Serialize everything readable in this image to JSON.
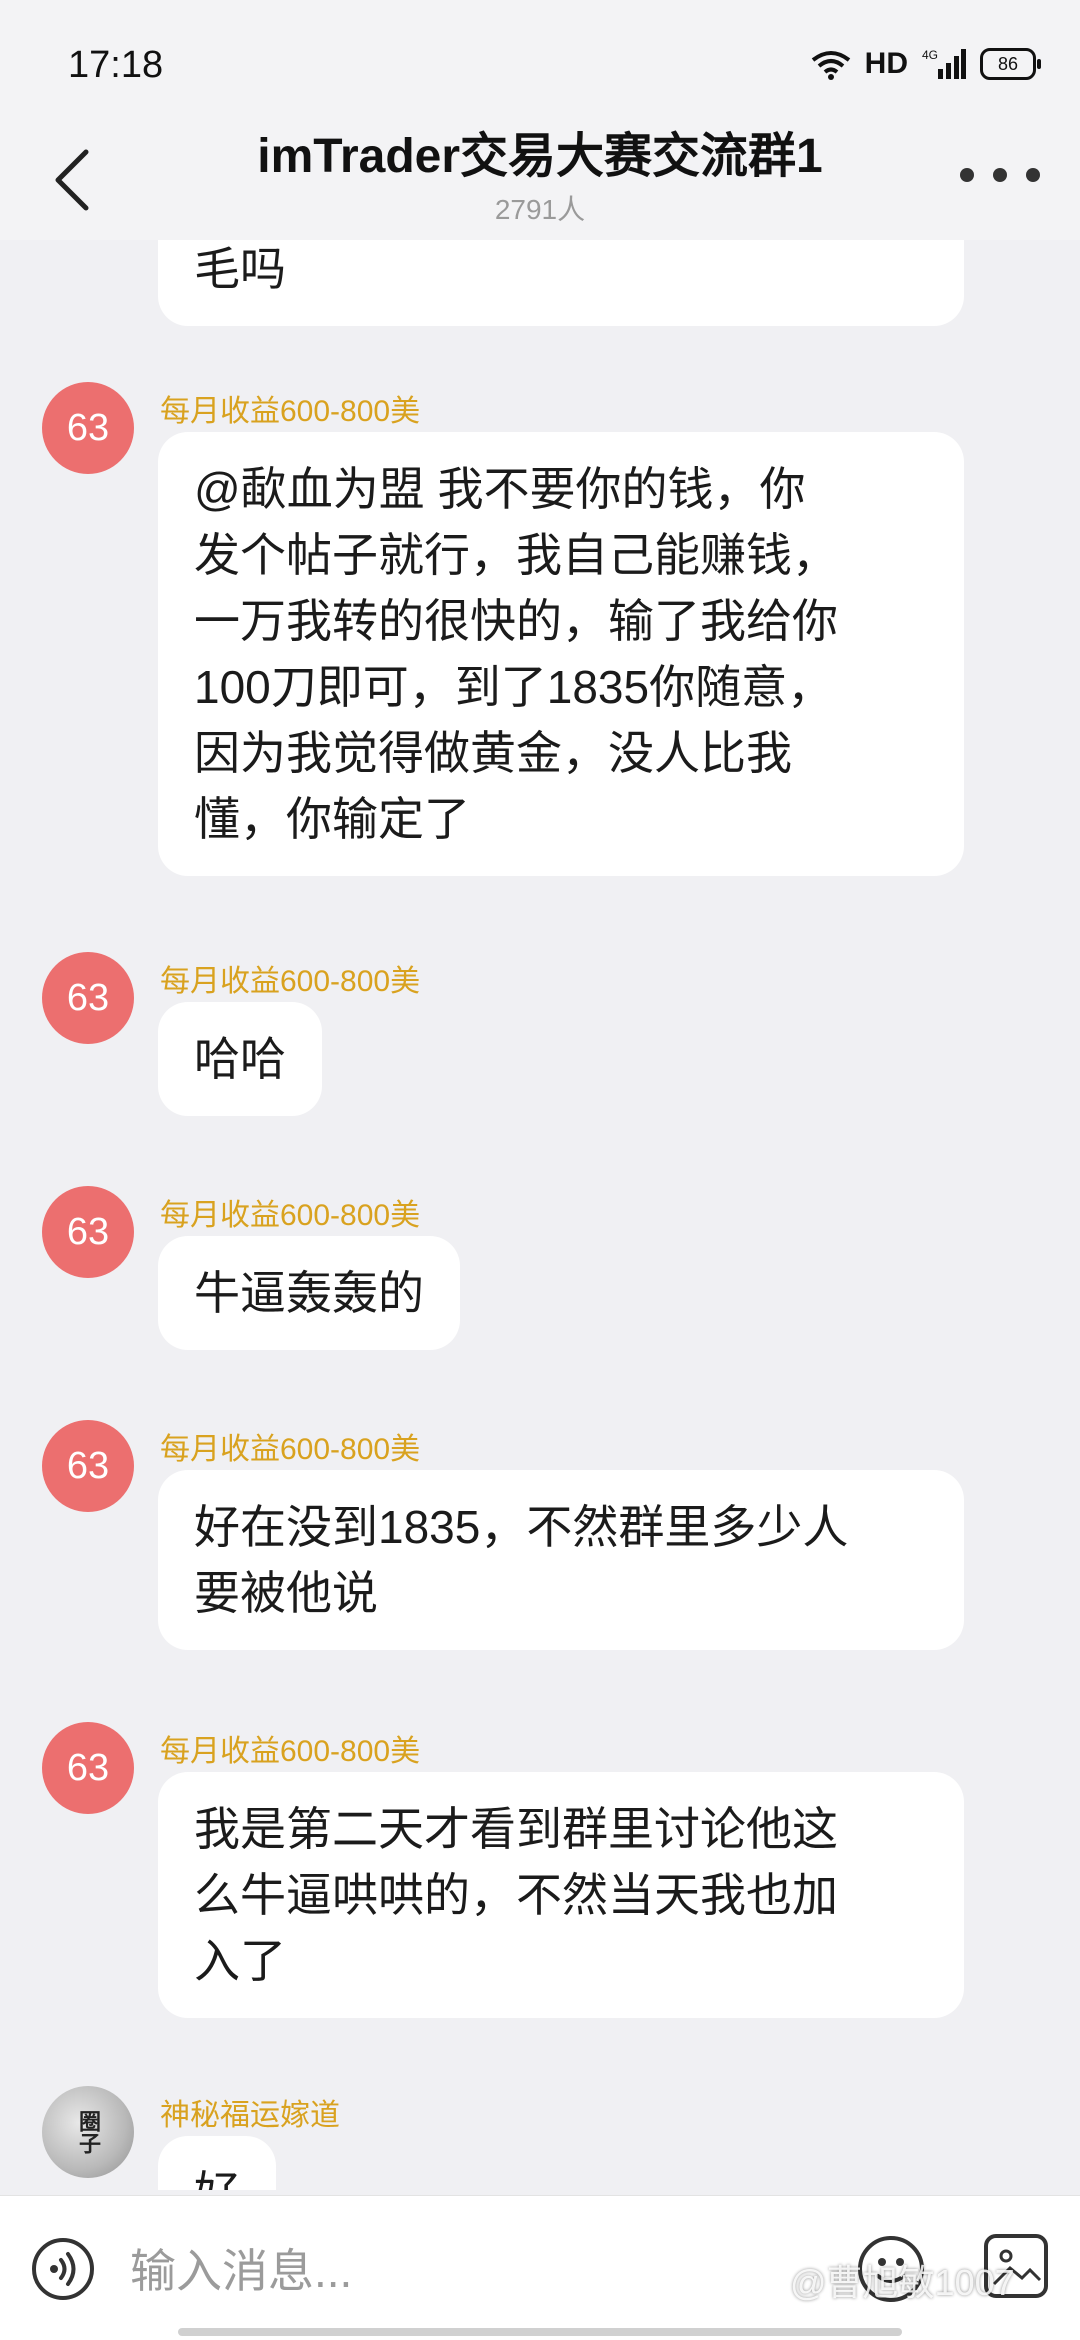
{
  "status_bar": {
    "time": "17:18",
    "network": "HD",
    "signal_label": "4G",
    "battery": "86"
  },
  "header": {
    "title": "imTrader交易大赛交流群1",
    "member_count": "2791人"
  },
  "messages": [
    {
      "sender": "",
      "avatar_text": "",
      "lines": [
        "毛吗"
      ]
    },
    {
      "sender": "每月收益600-800美",
      "avatar_text": "63",
      "lines": [
        "@歃血为盟 我不要你的钱，你",
        "发个帖子就行，我自己能赚钱，",
        "一万我转的很快的，输了我给你",
        "100刀即可，到了1835你随意，",
        "因为我觉得做黄金，没人比我",
        "懂，你输定了"
      ]
    },
    {
      "sender": "每月收益600-800美",
      "avatar_text": "63",
      "lines": [
        "哈哈"
      ]
    },
    {
      "sender": "每月收益600-800美",
      "avatar_text": "63",
      "lines": [
        "牛逼轰轰的"
      ]
    },
    {
      "sender": "每月收益600-800美",
      "avatar_text": "63",
      "lines": [
        "好在没到1835，不然群里多少人",
        "要被他说"
      ]
    },
    {
      "sender": "每月收益600-800美",
      "avatar_text": "63",
      "lines": [
        "我是第二天才看到群里讨论他这",
        "么牛逼哄哄的，不然当天我也加",
        "入了"
      ]
    },
    {
      "sender": "神秘福运嫁道",
      "avatar_text": "圈子",
      "lines": [
        "好"
      ]
    }
  ],
  "input_bar": {
    "placeholder": "输入消息...",
    "watermark": "@曹旭敏1007"
  },
  "colors": {
    "avatar_red": "#ec6f6f",
    "sender_gold": "#d9a21f",
    "background": "#f0f0f3"
  }
}
